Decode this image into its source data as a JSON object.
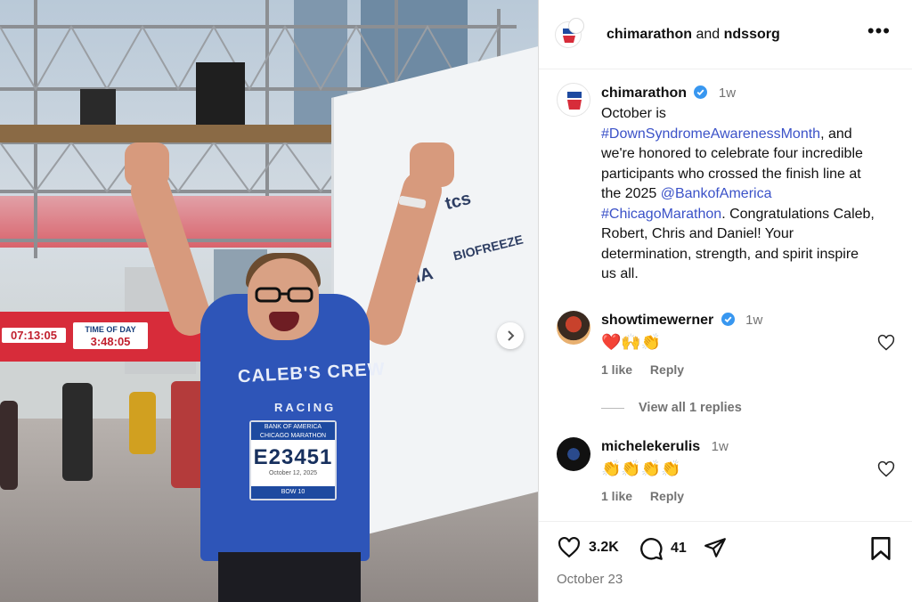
{
  "photo": {
    "timing_label": "TIME OF DAY",
    "timing_value": "3:48:05",
    "timing_left": "07:13:05",
    "wall_brand_1": "tcs",
    "wall_brand_2": "KIA",
    "wall_brand_3": "BIOFREEZE",
    "shirt_text": "CALEB'S CREW",
    "shirt_sub": "RACING",
    "bib_header": "BANK OF AMERICA CHICAGO MARATHON",
    "bib_number": "E23451",
    "bib_date": "October 12, 2025",
    "bib_footer": "BOW 10"
  },
  "header": {
    "account_1": "chimarathon",
    "joiner": "and",
    "account_2": "ndssorg",
    "more": "•••"
  },
  "post": {
    "username": "chimarathon",
    "time": "1w",
    "caption_1": "October is ",
    "tag_1": "#DownSyndromeAwarenessMonth",
    "caption_2": ", and we're honored to celebrate four incredible participants who crossed the finish line at the 2025 ",
    "tag_2": "@BankofAmerica",
    "caption_3": " ",
    "tag_3": "#ChicagoMarathon",
    "caption_4": ". Congratulations Caleb, Robert, Chris and Daniel! Your determination, strength, and spirit inspire us all."
  },
  "comments": [
    {
      "username": "showtimewerner",
      "time": "1w",
      "text": "❤️🙌👏",
      "likes": "1 like",
      "reply": "Reply"
    },
    {
      "username": "michelekerulis",
      "time": "1w",
      "text": "👏👏👏👏",
      "likes": "1 like",
      "reply": "Reply"
    }
  ],
  "view_replies": "View all 1 replies",
  "actions": {
    "likes": "3.2K",
    "comments": "41",
    "date": "October 23"
  },
  "colors": {
    "link": "#3b52c8",
    "verified": "#3897f0",
    "muted": "#737373"
  }
}
